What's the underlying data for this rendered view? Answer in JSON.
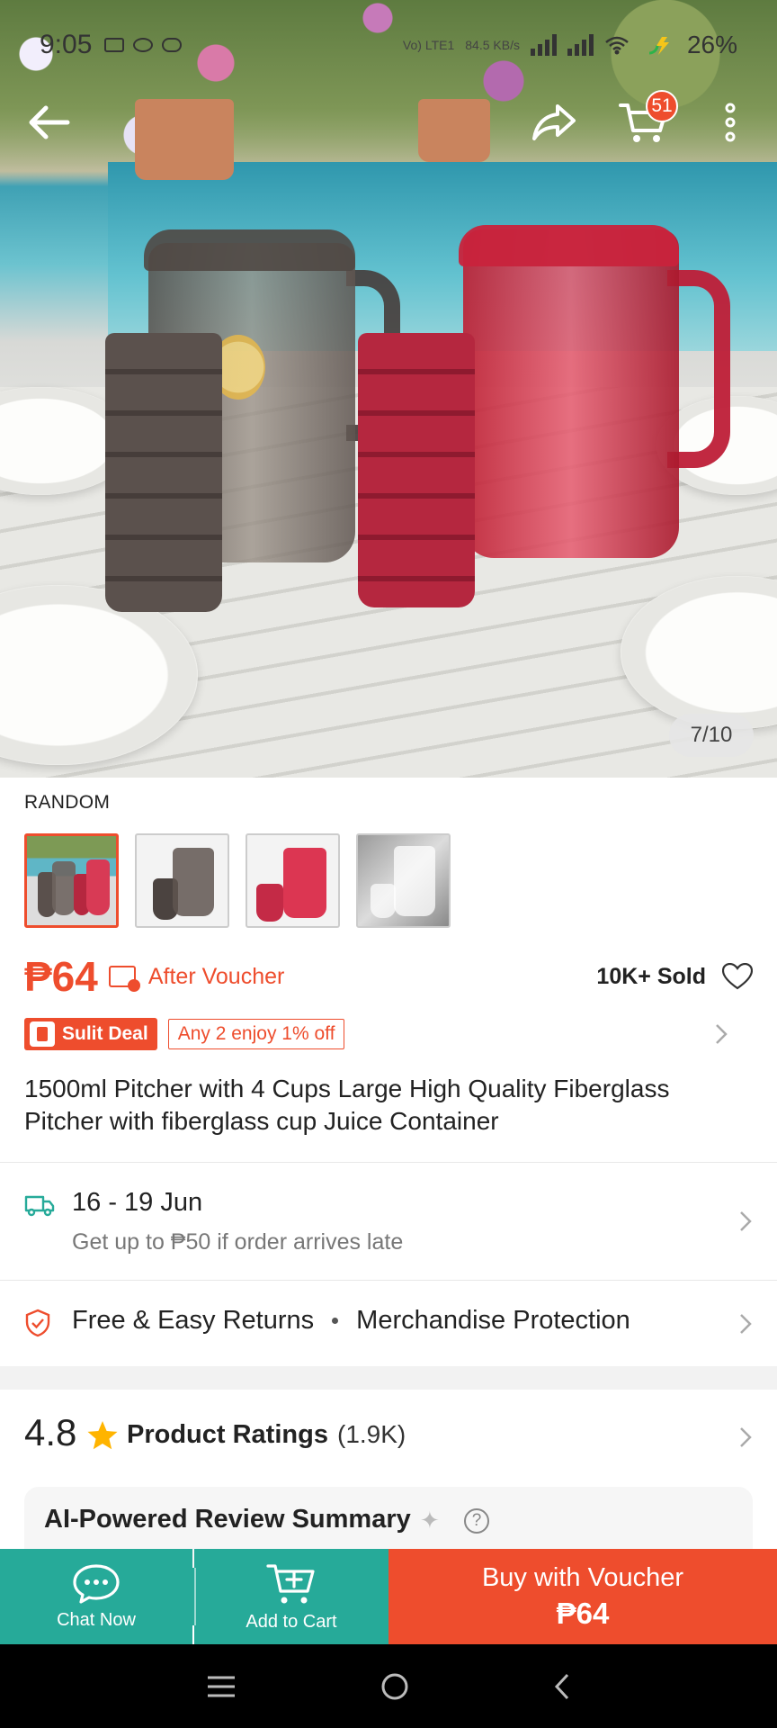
{
  "status_bar": {
    "time": "9:05",
    "network_top": "Vo) LTE1",
    "speed": "84.5 KB/s",
    "battery": "26%"
  },
  "gallery": {
    "counter": "7/10",
    "cart_badge": "51"
  },
  "variation": {
    "label": "RANDOM",
    "options": [
      "multi-color",
      "grey",
      "red",
      "clear"
    ]
  },
  "price": {
    "amount": "₱64",
    "after_voucher": "After Voucher",
    "sold": "10K+ Sold"
  },
  "deal": {
    "badge": "Sulit Deal",
    "tag": "Any 2 enjoy 1% off"
  },
  "product": {
    "title": "1500ml Pitcher with 4 Cups Large High Quality Fiberglass Pitcher with fiberglass cup Juice Container"
  },
  "shipping": {
    "date": "16 - 19 Jun",
    "note": "Get up to ₱50 if order arrives late"
  },
  "returns": {
    "item1": "Free & Easy Returns",
    "item2": "Merchandise Protection"
  },
  "ratings": {
    "score": "4.8",
    "label": "Product Ratings",
    "count": "(1.9K)"
  },
  "ai_summary": {
    "title": "AI-Powered Review Summary"
  },
  "actions": {
    "chat": "Chat Now",
    "add_to_cart": "Add to Cart",
    "buy_label": "Buy with Voucher",
    "buy_price": "₱64"
  },
  "colors": {
    "accent": "#ee4d2d",
    "teal": "#26aa99"
  }
}
